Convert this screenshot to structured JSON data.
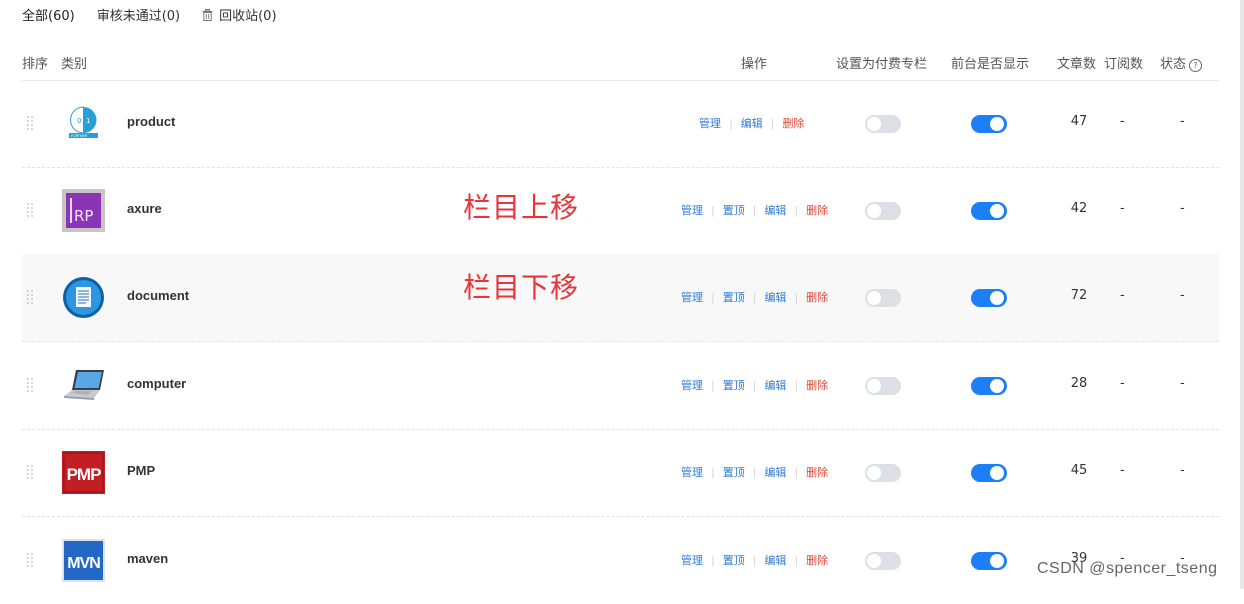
{
  "tabs": [
    {
      "label": "全部(60)",
      "active": true
    },
    {
      "label": "审核未通过(0)",
      "active": false
    },
    {
      "label": "回收站(0)",
      "active": false,
      "icon": "trash-icon"
    }
  ],
  "table": {
    "headers": {
      "order": "排序",
      "category": "类别",
      "actions": "操作",
      "paid": "设置为付费专栏",
      "show": "前台是否显示",
      "articles": "文章数",
      "subscribers": "订阅数",
      "status": "状态"
    },
    "status_help_icon": "question-circle-icon",
    "rows": [
      {
        "name": "product",
        "icon": "product-icon",
        "actions": [
          "管理",
          "编辑",
          "删除"
        ],
        "paid": false,
        "visible": true,
        "articles": "47",
        "subscribers": "-",
        "status": "-"
      },
      {
        "name": "axure",
        "icon": "axure-rp-icon",
        "actions": [
          "管理",
          "置顶",
          "编辑",
          "删除"
        ],
        "paid": false,
        "visible": true,
        "articles": "42",
        "subscribers": "-",
        "status": "-"
      },
      {
        "name": "document",
        "icon": "document-icon",
        "actions": [
          "管理",
          "置顶",
          "编辑",
          "删除"
        ],
        "paid": false,
        "visible": true,
        "articles": "72",
        "subscribers": "-",
        "status": "-"
      },
      {
        "name": "computer",
        "icon": "laptop-icon",
        "actions": [
          "管理",
          "置顶",
          "编辑",
          "删除"
        ],
        "paid": false,
        "visible": true,
        "articles": "28",
        "subscribers": "-",
        "status": "-"
      },
      {
        "name": "PMP",
        "icon": "pmp-icon",
        "actions": [
          "管理",
          "置顶",
          "编辑",
          "删除"
        ],
        "paid": false,
        "visible": true,
        "articles": "45",
        "subscribers": "-",
        "status": "-"
      },
      {
        "name": "maven",
        "icon": "mvn-icon",
        "actions": [
          "管理",
          "置顶",
          "编辑",
          "删除"
        ],
        "paid": false,
        "visible": true,
        "articles": "39",
        "subscribers": "-",
        "status": "-"
      }
    ]
  },
  "annotations": {
    "move_up": "栏目上移",
    "move_down": "栏目下移"
  },
  "watermark": "CSDN @spencer_tseng",
  "colors": {
    "link": "#2f7bd6",
    "delete": "#e0483a",
    "toggle_on": "#1d7ff7",
    "toggle_off": "#dcdfe6",
    "annotation": "#e8353c"
  }
}
